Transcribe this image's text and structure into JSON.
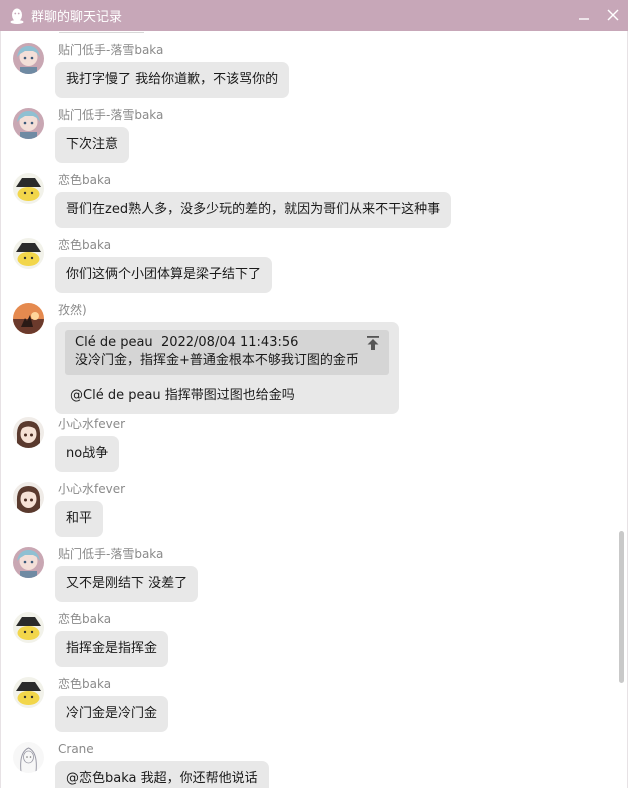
{
  "window": {
    "title": "群聊的聊天记录",
    "icons": {
      "app": "qq-penguin-icon",
      "minimize": "minimize-icon",
      "close": "close-icon"
    },
    "accent_color": "#c7a7b8"
  },
  "messages": [
    {
      "sender": "贴门低手-落雪baka",
      "avatar": "anime-girl-blue-hair",
      "text": "我打字慢了 我给你道歉，不该骂你的"
    },
    {
      "sender": "贴门低手-落雪baka",
      "avatar": "anime-girl-blue-hair",
      "text": "下次注意"
    },
    {
      "sender": "恋色baka",
      "avatar": "yellow-witch-hat-character",
      "text": "哥们在zed熟人多，没多少玩的差的，就因为哥们从来不干这种事"
    },
    {
      "sender": "恋色baka",
      "avatar": "yellow-witch-hat-character",
      "text": "你们这俩个小团体算是梁子结下了"
    },
    {
      "sender": "孜然)",
      "avatar": "sunset-silhouette",
      "quote": {
        "author": "Clé de peau",
        "time": "2022/08/04 11:43:56",
        "text": "没冷门金，指挥金+普通金根本不够我订图的金币",
        "icon": "jump-to-top-icon"
      },
      "text": "@Clé de peau 指挥带图过图也给金吗"
    },
    {
      "sender": "小心水fever",
      "avatar": "anime-girl-brown-hair",
      "text": "no战争"
    },
    {
      "sender": "小心水fever",
      "avatar": "anime-girl-brown-hair",
      "text": "和平"
    },
    {
      "sender": "贴门低手-落雪baka",
      "avatar": "anime-girl-blue-hair",
      "text": "又不是刚结下 没差了"
    },
    {
      "sender": "恋色baka",
      "avatar": "yellow-witch-hat-character",
      "text": "指挥金是指挥金"
    },
    {
      "sender": "恋色baka",
      "avatar": "yellow-witch-hat-character",
      "text": "冷门金是冷门金"
    },
    {
      "sender": "Crane",
      "avatar": "sketch-girl-white",
      "text": "@恋色baka 我超，你还帮他说话"
    }
  ]
}
